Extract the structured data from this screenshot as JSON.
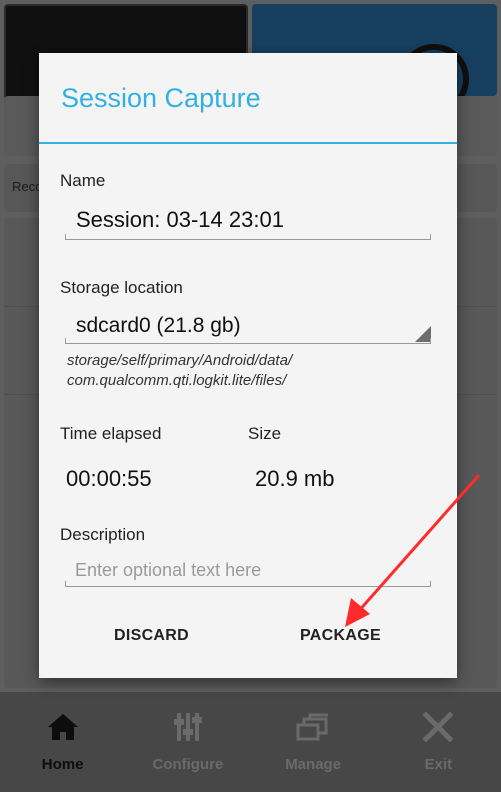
{
  "background": {
    "rec_label": "Reco"
  },
  "dialog": {
    "title": "Session Capture",
    "name_label": "Name",
    "name_value": "Session: 03-14 23:01",
    "storage_label": "Storage location",
    "storage_value": "sdcard0 (21.8 gb)",
    "storage_path_line1": "storage/self/primary/Android/data/",
    "storage_path_line2": "com.qualcomm.qti.logkit.lite/files/",
    "time_label": "Time elapsed",
    "time_value": "00:00:55",
    "size_label": "Size",
    "size_value": "20.9 mb",
    "description_label": "Description",
    "description_placeholder": "Enter optional text here",
    "discard_label": "DISCARD",
    "package_label": "PACKAGE"
  },
  "bottom_nav": [
    {
      "label": "Home",
      "icon": "home-icon",
      "active": true
    },
    {
      "label": "Configure",
      "icon": "sliders-icon",
      "active": false
    },
    {
      "label": "Manage",
      "icon": "folders-icon",
      "active": false
    },
    {
      "label": "Exit",
      "icon": "close-icon",
      "active": false
    }
  ],
  "colors": {
    "accent": "#33b0e0",
    "annotation_arrow": "#ff2a2a"
  }
}
